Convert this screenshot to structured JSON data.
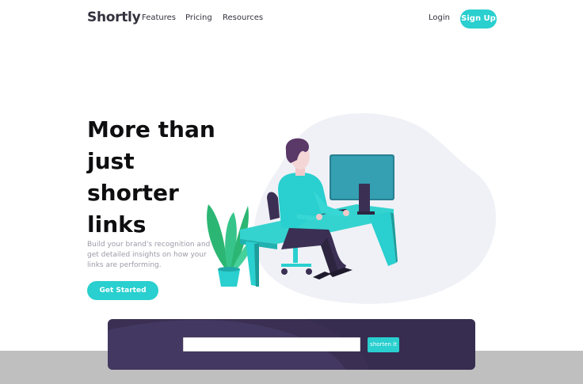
{
  "brand": {
    "name": "Shortly"
  },
  "nav": {
    "links": [
      "Features",
      "Pricing",
      "Resources"
    ],
    "login": "Login",
    "signup": "Sign Up"
  },
  "hero": {
    "title_lines": [
      "More than",
      "just",
      "shorter",
      "links"
    ],
    "subtitle": "Build your brand's recognition and get detailed insights on how your links are performing.",
    "cta": "Get Started",
    "illustration": "person-working-at-desk-illustration"
  },
  "shorten": {
    "input_value": "",
    "input_placeholder": "",
    "button": "shorten it"
  },
  "colors": {
    "accent": "#2acfcf",
    "dark_violet": "#3b3054",
    "text_dark": "#34313d",
    "text_gray": "#9e9aa7",
    "blob": "#f0f1f6",
    "band": "#bfbfbf"
  }
}
